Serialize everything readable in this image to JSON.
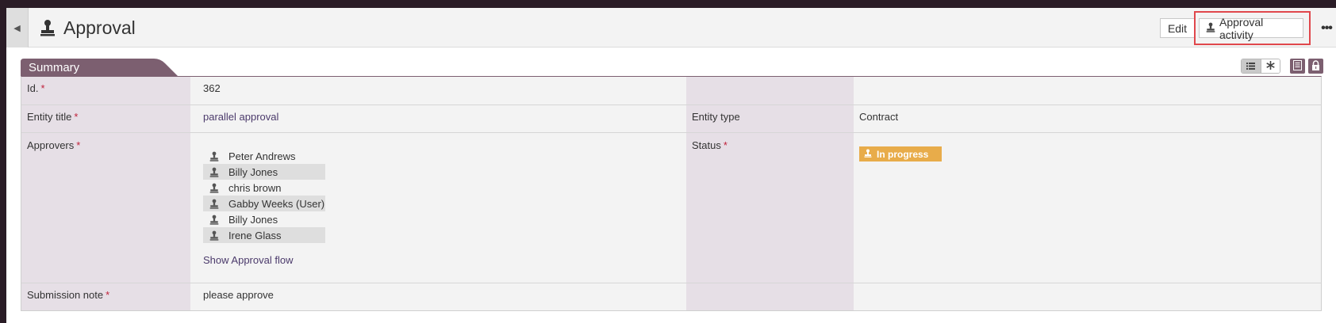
{
  "header": {
    "title": "Approval",
    "title_icon": "stamp-icon",
    "edit_label": "Edit",
    "approval_activity_label": "Approval activity",
    "more_label": "•••",
    "collapse_glyph": "◀"
  },
  "summary": {
    "tab_label": "Summary",
    "fields": {
      "id_label": "Id.",
      "id_value": "362",
      "entity_title_label": "Entity title",
      "entity_title_value": "parallel approval",
      "entity_type_label": "Entity type",
      "entity_type_value": "Contract",
      "approvers_label": "Approvers",
      "status_label": "Status",
      "status_value": "In progress",
      "submission_note_label": "Submission note",
      "submission_note_value": "please approve",
      "show_flow_label": "Show Approval flow",
      "required_mark": "*"
    },
    "approvers": [
      {
        "name": "Peter Andrews",
        "shaded": false
      },
      {
        "name": "Billy Jones",
        "shaded": true
      },
      {
        "name": "chris brown",
        "shaded": false
      },
      {
        "name": "Gabby Weeks (User)",
        "shaded": true
      },
      {
        "name": "Billy Jones",
        "shaded": false
      },
      {
        "name": "Irene Glass",
        "shaded": true
      }
    ]
  },
  "colors": {
    "accent": "#7c5f70",
    "status_in_progress": "#e8ac4a",
    "highlight": "#e0474c",
    "required": "#c0223b"
  }
}
